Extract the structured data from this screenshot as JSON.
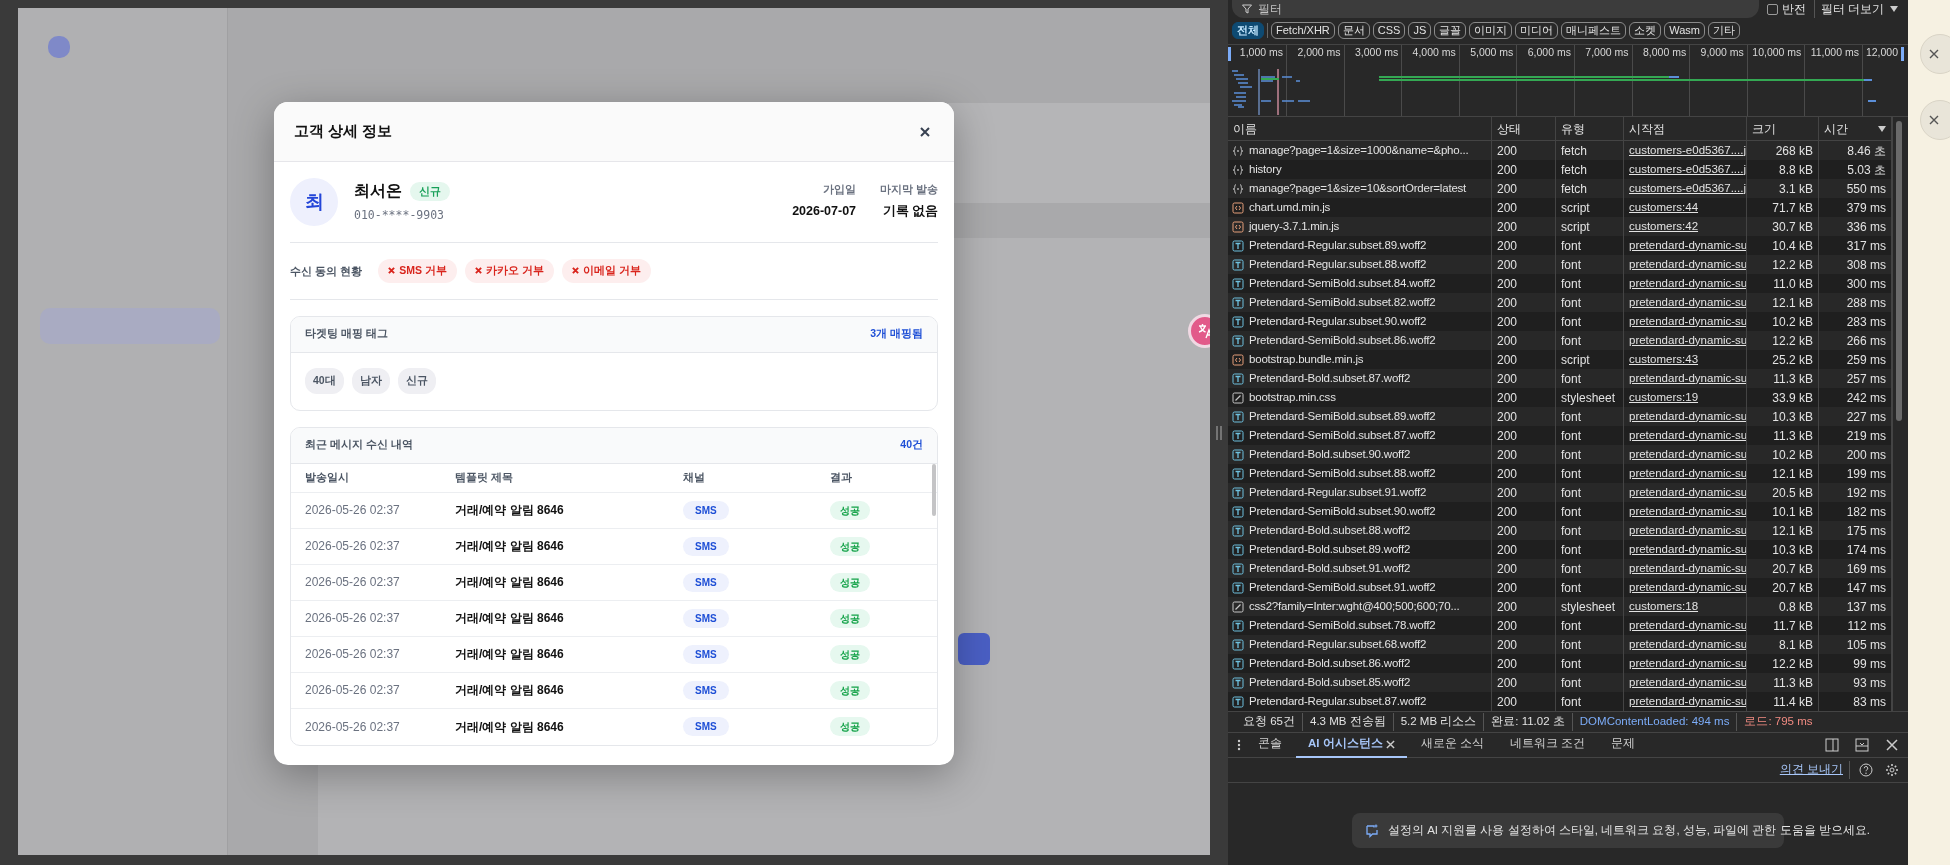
{
  "modal": {
    "title": "고객 상세 정보",
    "customer": {
      "avatar": "최",
      "name": "최서온",
      "badge": "신규",
      "phone": "010-****-9903",
      "stats": [
        {
          "label": "가입일",
          "value": "2026-07-07"
        },
        {
          "label": "마지막 발송",
          "value": "기록 없음"
        }
      ]
    },
    "consent": {
      "label": "수신 동의 현황",
      "items": [
        {
          "text": "SMS 거부",
          "agreed": false
        },
        {
          "text": "카카오 거부",
          "agreed": false
        },
        {
          "text": "이메일 거부",
          "agreed": false
        }
      ]
    },
    "tags_card": {
      "title": "타겟팅 매핑 태그",
      "count": "3개 매핑됨",
      "tags": [
        "40대",
        "남자",
        "신규"
      ]
    },
    "history": {
      "title": "최근 메시지 수신 내역",
      "count": "40건",
      "columns": [
        "발송일시",
        "템플릿 제목",
        "채널",
        "결과"
      ],
      "rows": [
        {
          "sent_at": "2026-05-26 02:37",
          "template": "거래/예약 알림 8646",
          "channel": "SMS",
          "result": "성공"
        },
        {
          "sent_at": "2026-05-26 02:37",
          "template": "거래/예약 알림 8646",
          "channel": "SMS",
          "result": "성공"
        },
        {
          "sent_at": "2026-05-26 02:37",
          "template": "거래/예약 알림 8646",
          "channel": "SMS",
          "result": "성공"
        },
        {
          "sent_at": "2026-05-26 02:37",
          "template": "거래/예약 알림 8646",
          "channel": "SMS",
          "result": "성공"
        },
        {
          "sent_at": "2026-05-26 02:37",
          "template": "거래/예약 알림 8646",
          "channel": "SMS",
          "result": "성공"
        },
        {
          "sent_at": "2026-05-26 02:37",
          "template": "거래/예약 알림 8646",
          "channel": "SMS",
          "result": "성공"
        },
        {
          "sent_at": "2026-05-26 02:37",
          "template": "거래/예약 알림 8646",
          "channel": "SMS",
          "result": "성공"
        }
      ]
    }
  },
  "devtools": {
    "filter": {
      "placeholder": "필터",
      "invert": {
        "label": "반전",
        "checked": false
      },
      "more": "필터 더보기"
    },
    "type_filters": [
      {
        "label": "전체",
        "selected": true
      },
      {
        "label": "Fetch/XHR",
        "selected": false
      },
      {
        "label": "문서",
        "selected": false
      },
      {
        "label": "CSS",
        "selected": false
      },
      {
        "label": "JS",
        "selected": false
      },
      {
        "label": "글꼴",
        "selected": false
      },
      {
        "label": "이미지",
        "selected": false
      },
      {
        "label": "미디어",
        "selected": false
      },
      {
        "label": "매니페스트",
        "selected": false
      },
      {
        "label": "소켓",
        "selected": false
      },
      {
        "label": "Wasm",
        "selected": false
      },
      {
        "label": "기타",
        "selected": false
      }
    ],
    "timeline_ticks": [
      "1,000 ms",
      "2,000 ms",
      "3,000 ms",
      "4,000 ms",
      "5,000 ms",
      "6,000 ms",
      "7,000 ms",
      "8,000 ms",
      "9,000 ms",
      "10,000 ms",
      "11,000 ms",
      "12,000"
    ],
    "columns": [
      {
        "label": "이름",
        "sorted": false
      },
      {
        "label": "상태",
        "sorted": false
      },
      {
        "label": "유형",
        "sorted": false
      },
      {
        "label": "시작점",
        "sorted": false
      },
      {
        "label": "크기",
        "sorted": false
      },
      {
        "label": "시간",
        "sorted": true
      }
    ],
    "requests": [
      {
        "kind": "fetch",
        "name": "manage?page=1&size=1000&name=&pho...",
        "status": "200",
        "type": "fetch",
        "initiator": "customers-e0d5367....j",
        "size": "268 kB",
        "time": "8.46 초"
      },
      {
        "kind": "fetch",
        "name": "history",
        "status": "200",
        "type": "fetch",
        "initiator": "customers-e0d5367....j",
        "size": "8.8 kB",
        "time": "5.03 초"
      },
      {
        "kind": "fetch",
        "name": "manage?page=1&size=10&sortOrder=latest",
        "status": "200",
        "type": "fetch",
        "initiator": "customers-e0d5367....j",
        "size": "3.1 kB",
        "time": "550 ms"
      },
      {
        "kind": "script",
        "name": "chart.umd.min.js",
        "status": "200",
        "type": "script",
        "initiator": "customers:44",
        "size": "71.7 kB",
        "time": "379 ms"
      },
      {
        "kind": "script",
        "name": "jquery-3.7.1.min.js",
        "status": "200",
        "type": "script",
        "initiator": "customers:42",
        "size": "30.7 kB",
        "time": "336 ms"
      },
      {
        "kind": "font",
        "name": "Pretendard-Regular.subset.89.woff2",
        "status": "200",
        "type": "font",
        "initiator": "pretendard-dynamic-su",
        "size": "10.4 kB",
        "time": "317 ms"
      },
      {
        "kind": "font",
        "name": "Pretendard-Regular.subset.88.woff2",
        "status": "200",
        "type": "font",
        "initiator": "pretendard-dynamic-su",
        "size": "12.2 kB",
        "time": "308 ms"
      },
      {
        "kind": "font",
        "name": "Pretendard-SemiBold.subset.84.woff2",
        "status": "200",
        "type": "font",
        "initiator": "pretendard-dynamic-su",
        "size": "11.0 kB",
        "time": "300 ms"
      },
      {
        "kind": "font",
        "name": "Pretendard-SemiBold.subset.82.woff2",
        "status": "200",
        "type": "font",
        "initiator": "pretendard-dynamic-su",
        "size": "12.1 kB",
        "time": "288 ms"
      },
      {
        "kind": "font",
        "name": "Pretendard-Regular.subset.90.woff2",
        "status": "200",
        "type": "font",
        "initiator": "pretendard-dynamic-su",
        "size": "10.2 kB",
        "time": "283 ms"
      },
      {
        "kind": "font",
        "name": "Pretendard-SemiBold.subset.86.woff2",
        "status": "200",
        "type": "font",
        "initiator": "pretendard-dynamic-su",
        "size": "12.2 kB",
        "time": "266 ms"
      },
      {
        "kind": "script",
        "name": "bootstrap.bundle.min.js",
        "status": "200",
        "type": "script",
        "initiator": "customers:43",
        "size": "25.2 kB",
        "time": "259 ms"
      },
      {
        "kind": "font",
        "name": "Pretendard-Bold.subset.87.woff2",
        "status": "200",
        "type": "font",
        "initiator": "pretendard-dynamic-su",
        "size": "11.3 kB",
        "time": "257 ms"
      },
      {
        "kind": "stylesheet",
        "name": "bootstrap.min.css",
        "status": "200",
        "type": "stylesheet",
        "initiator": "customers:19",
        "size": "33.9 kB",
        "time": "242 ms"
      },
      {
        "kind": "font",
        "name": "Pretendard-SemiBold.subset.89.woff2",
        "status": "200",
        "type": "font",
        "initiator": "pretendard-dynamic-su",
        "size": "10.3 kB",
        "time": "227 ms"
      },
      {
        "kind": "font",
        "name": "Pretendard-SemiBold.subset.87.woff2",
        "status": "200",
        "type": "font",
        "initiator": "pretendard-dynamic-su",
        "size": "11.3 kB",
        "time": "219 ms"
      },
      {
        "kind": "font",
        "name": "Pretendard-Bold.subset.90.woff2",
        "status": "200",
        "type": "font",
        "initiator": "pretendard-dynamic-su",
        "size": "10.2 kB",
        "time": "200 ms"
      },
      {
        "kind": "font",
        "name": "Pretendard-SemiBold.subset.88.woff2",
        "status": "200",
        "type": "font",
        "initiator": "pretendard-dynamic-su",
        "size": "12.1 kB",
        "time": "199 ms"
      },
      {
        "kind": "font",
        "name": "Pretendard-Regular.subset.91.woff2",
        "status": "200",
        "type": "font",
        "initiator": "pretendard-dynamic-su",
        "size": "20.5 kB",
        "time": "192 ms"
      },
      {
        "kind": "font",
        "name": "Pretendard-SemiBold.subset.90.woff2",
        "status": "200",
        "type": "font",
        "initiator": "pretendard-dynamic-su",
        "size": "10.1 kB",
        "time": "182 ms"
      },
      {
        "kind": "font",
        "name": "Pretendard-Bold.subset.88.woff2",
        "status": "200",
        "type": "font",
        "initiator": "pretendard-dynamic-su",
        "size": "12.1 kB",
        "time": "175 ms"
      },
      {
        "kind": "font",
        "name": "Pretendard-Bold.subset.89.woff2",
        "status": "200",
        "type": "font",
        "initiator": "pretendard-dynamic-su",
        "size": "10.3 kB",
        "time": "174 ms"
      },
      {
        "kind": "font",
        "name": "Pretendard-Bold.subset.91.woff2",
        "status": "200",
        "type": "font",
        "initiator": "pretendard-dynamic-su",
        "size": "20.7 kB",
        "time": "169 ms"
      },
      {
        "kind": "font",
        "name": "Pretendard-SemiBold.subset.91.woff2",
        "status": "200",
        "type": "font",
        "initiator": "pretendard-dynamic-su",
        "size": "20.7 kB",
        "time": "147 ms"
      },
      {
        "kind": "stylesheet",
        "name": "css2?family=Inter:wght@400;500;600;70...",
        "status": "200",
        "type": "stylesheet",
        "initiator": "customers:18",
        "size": "0.8 kB",
        "time": "137 ms"
      },
      {
        "kind": "font",
        "name": "Pretendard-SemiBold.subset.78.woff2",
        "status": "200",
        "type": "font",
        "initiator": "pretendard-dynamic-su",
        "size": "11.7 kB",
        "time": "112 ms"
      },
      {
        "kind": "font",
        "name": "Pretendard-Regular.subset.68.woff2",
        "status": "200",
        "type": "font",
        "initiator": "pretendard-dynamic-su",
        "size": "8.1 kB",
        "time": "105 ms"
      },
      {
        "kind": "font",
        "name": "Pretendard-Bold.subset.86.woff2",
        "status": "200",
        "type": "font",
        "initiator": "pretendard-dynamic-su",
        "size": "12.2 kB",
        "time": "99 ms"
      },
      {
        "kind": "font",
        "name": "Pretendard-Bold.subset.85.woff2",
        "status": "200",
        "type": "font",
        "initiator": "pretendard-dynamic-su",
        "size": "11.3 kB",
        "time": "93 ms"
      },
      {
        "kind": "font",
        "name": "Pretendard-Regular.subset.87.woff2",
        "status": "200",
        "type": "font",
        "initiator": "pretendard-dynamic-su",
        "size": "11.4 kB",
        "time": "83 ms"
      }
    ],
    "summary": [
      {
        "kind": "plain",
        "text": "요청 65건"
      },
      {
        "kind": "plain",
        "text": "4.3 MB 전송됨"
      },
      {
        "kind": "plain",
        "text": "5.2 MB 리소스"
      },
      {
        "kind": "plain",
        "text": "완료: 11.02 초"
      },
      {
        "kind": "dcl",
        "text": "DOMContentLoaded: 494 ms"
      },
      {
        "kind": "load",
        "text": "로드: 795 ms"
      }
    ],
    "drawer_tabs": [
      {
        "label": "콘솔",
        "selected": false,
        "closable": false
      },
      {
        "label": "AI 어시스턴스",
        "selected": true,
        "closable": true
      },
      {
        "label": "새로운 소식",
        "selected": false,
        "closable": false
      },
      {
        "label": "네트워크 조건",
        "selected": false,
        "closable": false
      },
      {
        "label": "문제",
        "selected": false,
        "closable": false
      }
    ],
    "feedback_link": "의견 보내기",
    "ai_notice": {
      "link": "설정의 AI 지원",
      "text": "를 사용 설정하여 스타일, 네트워크 요청, 성능, 파일에 관한 도움을 받으세요."
    }
  }
}
